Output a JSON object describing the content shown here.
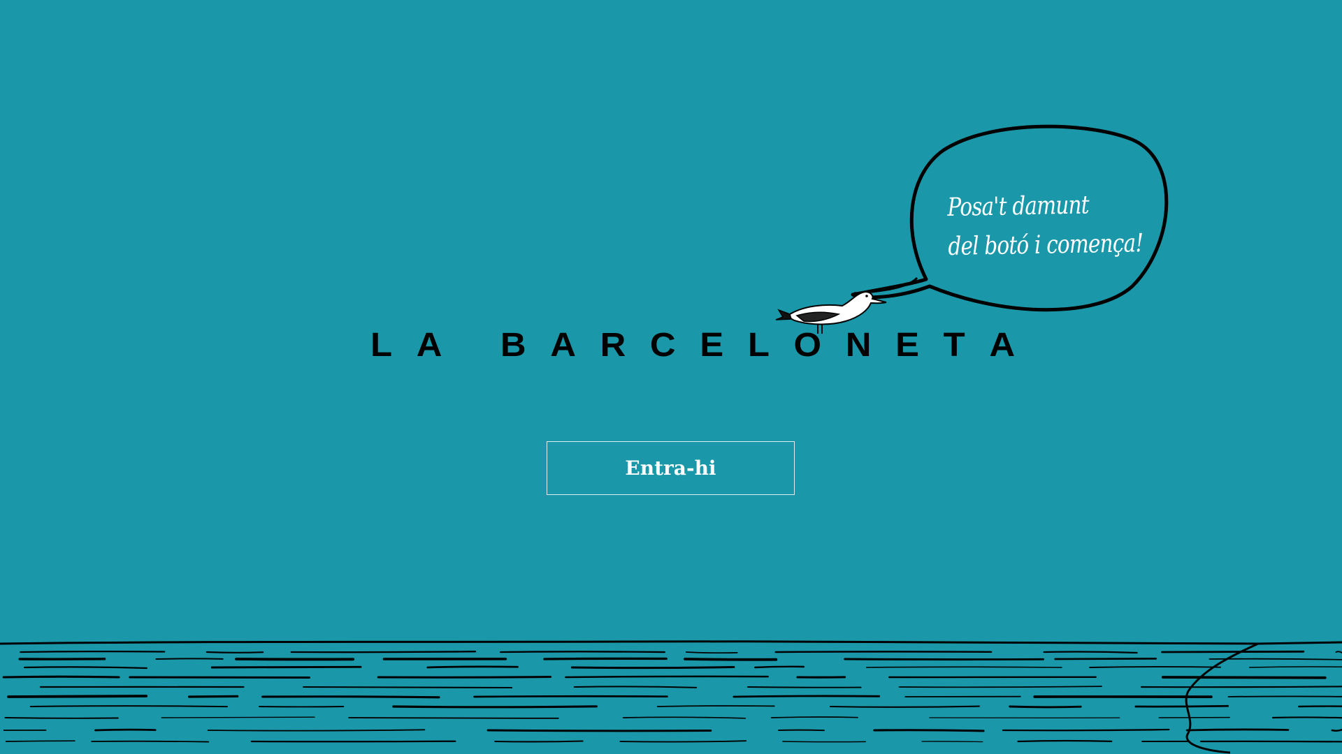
{
  "site": {
    "title": "LA BARCELONETA"
  },
  "speech_bubble": {
    "line1": "Posa't damunt",
    "line2": "del botó i comença!"
  },
  "enter_button": {
    "label": "Entra-hi"
  },
  "colors": {
    "background": "#1a98a9",
    "title": "#000000",
    "button_text": "#ffffff",
    "button_border": "#ffffff",
    "ink": "#000000"
  },
  "icons": {
    "seagull": "seagull-illustration",
    "bubble": "speech-bubble-outline",
    "sea": "sea-waves-illustration"
  }
}
